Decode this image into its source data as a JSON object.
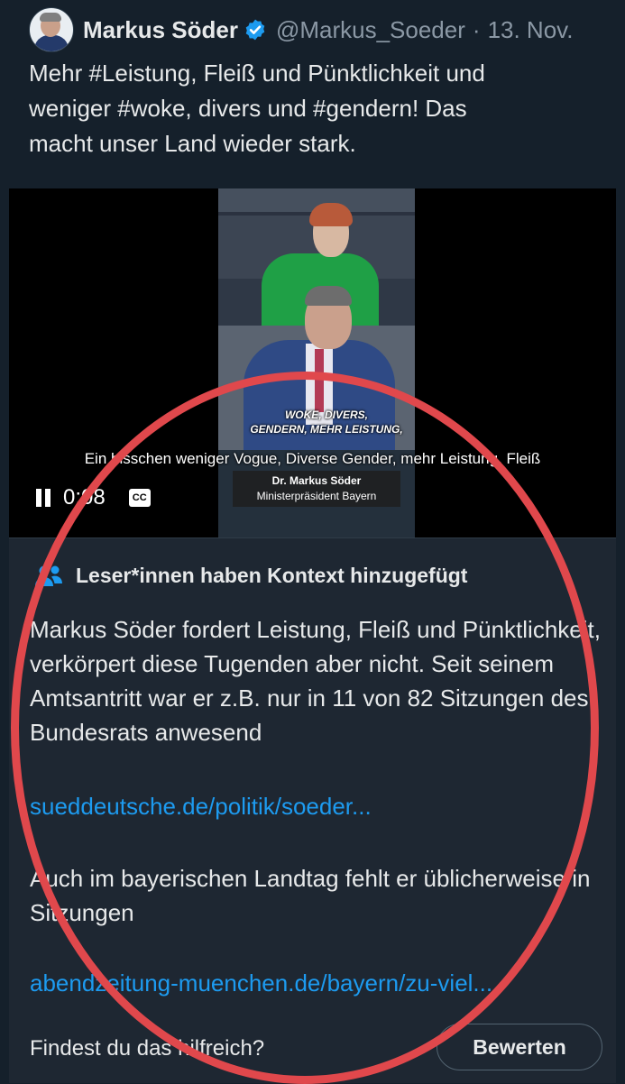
{
  "tweet": {
    "author_name": "Markus Söder",
    "handle": "@Markus_Soeder",
    "separator": "·",
    "date": "13. Nov.",
    "text": "Mehr #Leistung, Fleiß und Pünktlichkeit und\nweniger #woke, divers und #gendern! Das\nmacht unser Land wieder stark."
  },
  "video": {
    "overlay_caption": "WOKE, DIVERS,\nGENDERN, MEHR LEISTUNG,",
    "subtitle": "Ein bisschen weniger Vogue, Diverse Gender, mehr Leistung, Fleiß",
    "nameplate_name": "Dr. Markus Söder",
    "nameplate_role": "Ministerpräsident Bayern",
    "time": "0:08",
    "cc_label": "CC",
    "state": "playing"
  },
  "community_note": {
    "title": "Leser*innen haben Kontext hinzugefügt",
    "body": "Markus Söder fordert Leistung, Fleiß und Pünktlichkeit, verkörpert diese Tugenden aber nicht. Seit seinem Amtsantritt war er z.B. nur in 11 von 82 Sitzungen des Bundesrats anwesend",
    "link1": "sueddeutsche.de/politik/soeder...",
    "body2": "Auch im bayerischen Landtag fehlt er üblicherweise in Sitzungen",
    "link2": "abendzeitung-muenchen.de/bayern/zu-viel...",
    "question": "Findest du das hilfreich?",
    "rate_button": "Bewerten"
  },
  "colors": {
    "background": "#15202b",
    "note_background": "#1e2732",
    "link": "#1d9bf0",
    "verified": "#1d9bf0",
    "annotation_ring": "#e0484c"
  },
  "icons": [
    "verified-badge-icon",
    "pause-icon",
    "cc-icon",
    "people-icon"
  ]
}
